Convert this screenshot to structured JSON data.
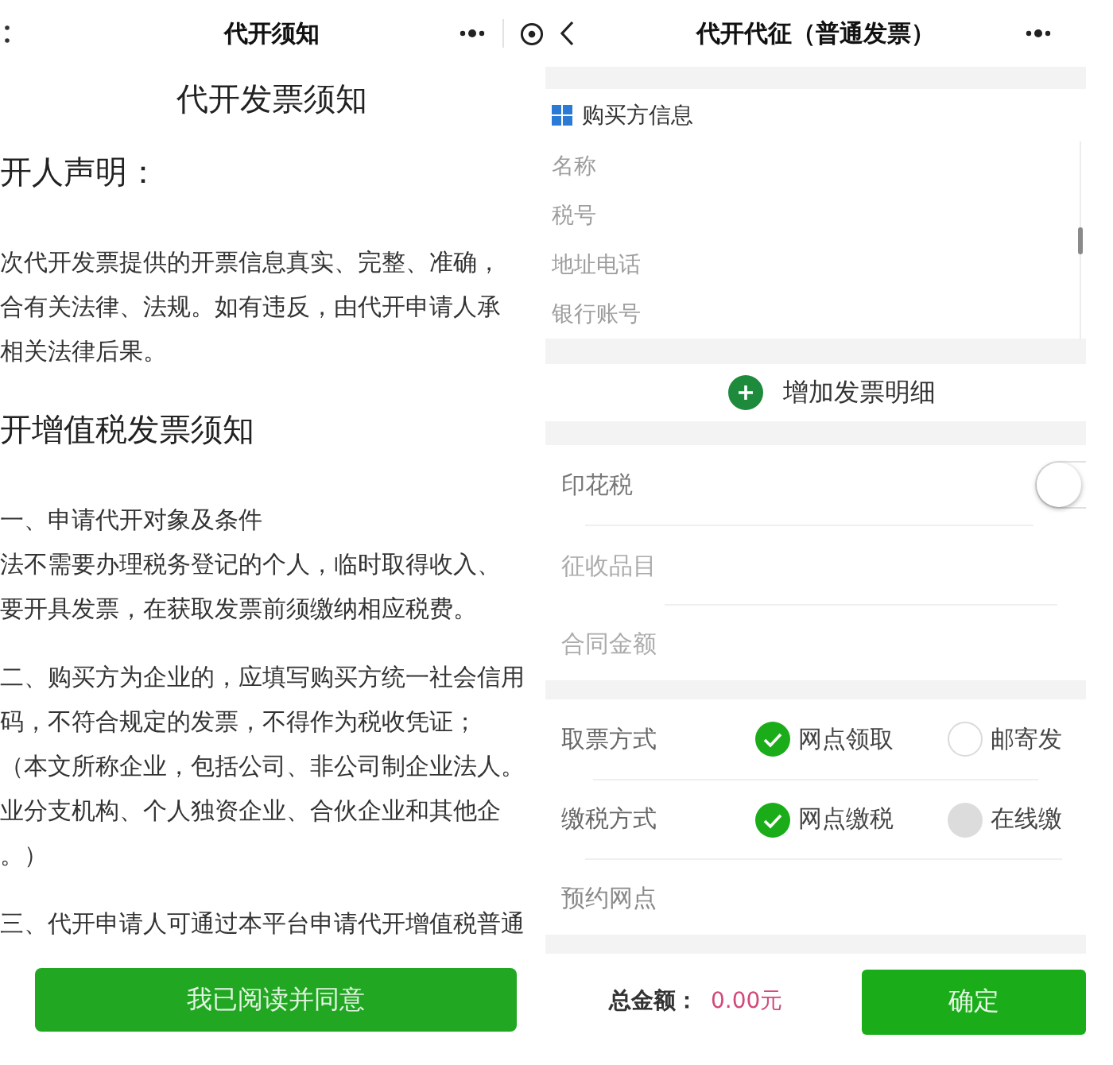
{
  "notice_screen": {
    "nav_bar": {
      "title": "代开须知"
    },
    "heading": "代开发票须知",
    "sections": [
      {
        "title": "开人声明：",
        "paragraphs": [
          {
            "lines": [
              "次代开发票提供的开票信息真实、完整、准确，",
              "合有关法律、法规。如有违反，由代开申请人承",
              "相关法律后果。"
            ]
          }
        ]
      },
      {
        "title": "开增值税发票须知",
        "paragraphs": [
          {
            "lines": [
              "一、申请代开对象及条件",
              "法不需要办理税务登记的个人，临时取得收入、",
              "要开具发票，在获取发票前须缴纳相应税费。"
            ]
          },
          {
            "lines": [
              "二、购买方为企业的，应填写购买方统一社会信用",
              "码，不符合规定的发票，不得作为税收凭证；",
              "（本文所称企业，包括公司、非公司制企业法人。",
              "业分支机构、个人独资企业、合伙企业和其他企",
              "。）"
            ]
          },
          {
            "lines": [
              "三、代开申请人可通过本平台申请代开增值税普通"
            ]
          }
        ]
      }
    ],
    "agree_button": "我已阅读并同意"
  },
  "invoice_screen": {
    "nav_bar": {
      "title": "代开代征（普通发票）"
    },
    "buyer_section": {
      "title": "购买方信息",
      "fields": [
        {
          "placeholder": "名称"
        },
        {
          "placeholder": "税号"
        },
        {
          "placeholder": "地址电话"
        },
        {
          "placeholder": "银行账号"
        }
      ]
    },
    "add_detail_button": "增加发票明细",
    "stamp_tax": {
      "label": "印花税",
      "on": false
    },
    "tax_fields": [
      {
        "placeholder": "征收品目",
        "disabled": true
      },
      {
        "placeholder": "合同金额",
        "disabled": true
      }
    ],
    "options": [
      {
        "label": "取票方式",
        "choices": [
          {
            "label": "网点领取",
            "selected": true,
            "disabled": false
          },
          {
            "label": "邮寄发",
            "selected": false,
            "disabled": false
          }
        ]
      },
      {
        "label": "缴税方式",
        "choices": [
          {
            "label": "网点缴税",
            "selected": true,
            "disabled": false
          },
          {
            "label": "在线缴",
            "selected": false,
            "disabled": true
          }
        ]
      }
    ],
    "outlet_field": {
      "placeholder": "预约网点"
    },
    "footer": {
      "total_label": "总金额：",
      "total_value": "0.00元",
      "confirm_button": "确定"
    }
  }
}
